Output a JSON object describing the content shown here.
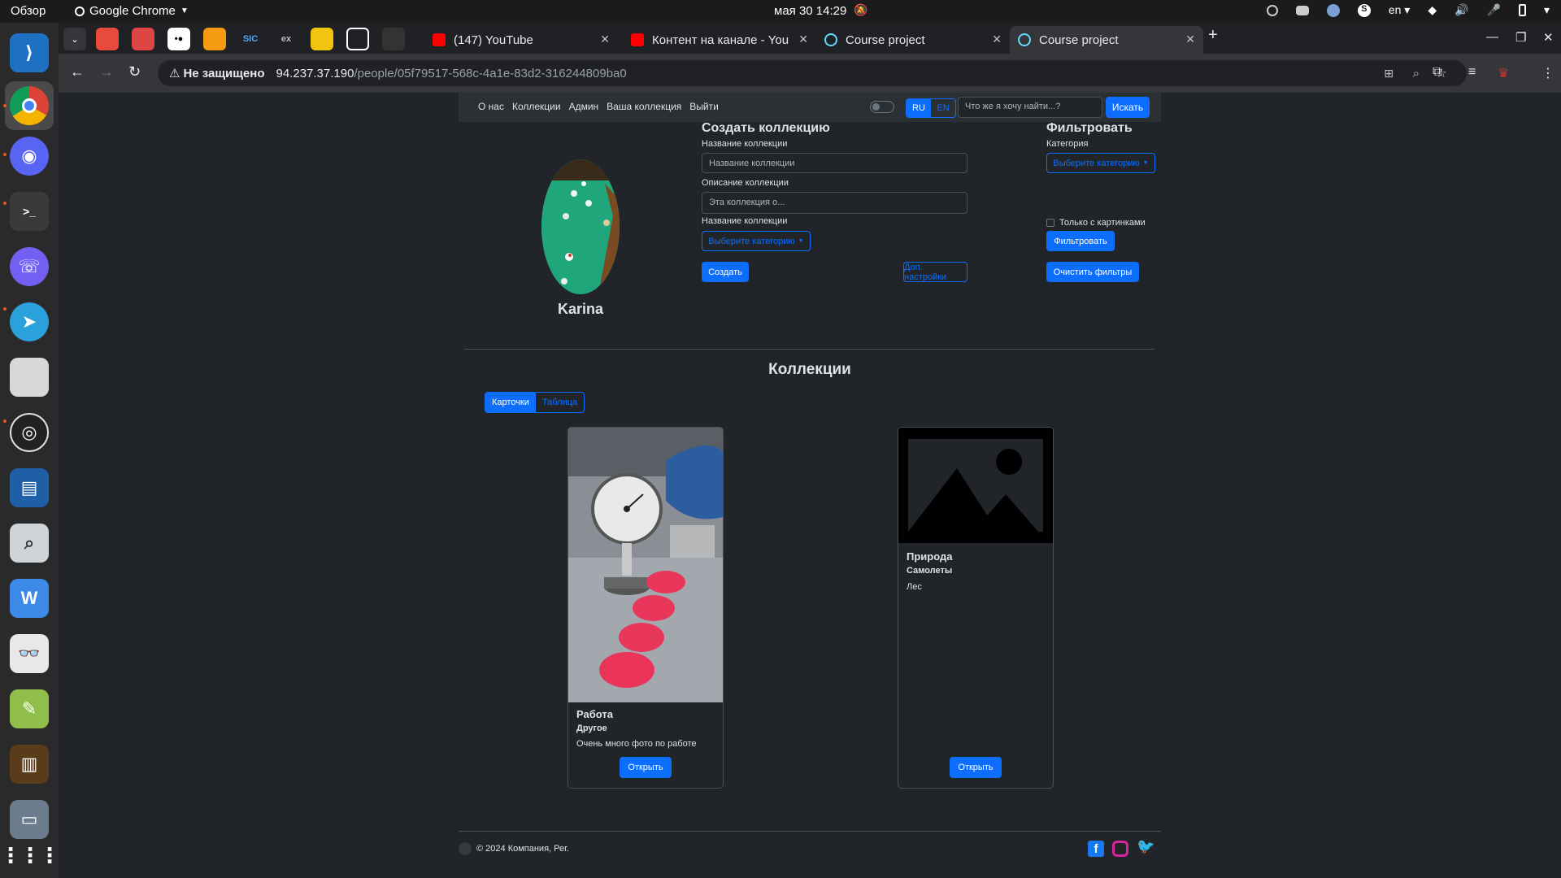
{
  "system": {
    "overview": "Обзор",
    "app_name": "Google Chrome",
    "clock": "мая 30  14:29",
    "lang": "en"
  },
  "browser": {
    "tabs": [
      {
        "label": "(147) YouTube"
      },
      {
        "label": "Контент на канале - You"
      },
      {
        "label": "Course project"
      },
      {
        "label": "Course project"
      }
    ],
    "small_tabs": [
      "SIC",
      "ex"
    ],
    "insecure_label": "Не защищено",
    "url_host": "94.237.37.190",
    "url_path": "/people/05f79517-568c-4a1e-83d2-316244809ba0"
  },
  "nav": {
    "links": [
      "О нас",
      "Коллекции",
      "Админ",
      "Ваша коллекция",
      "Выйти"
    ],
    "lang_ru": "RU",
    "lang_en": "EN",
    "search_placeholder": "Что же я хочу найти...?",
    "search_button": "Искать"
  },
  "profile": {
    "name": "Karina"
  },
  "create": {
    "title": "Создать коллекцию",
    "name_label": "Название коллекции",
    "name_placeholder": "Название коллекции",
    "desc_label": "Описание коллекции",
    "desc_placeholder": "Эта коллекция о...",
    "category_label": "Название коллекции",
    "category_button": "Выберите категорию",
    "create_button": "Создать",
    "extra_button": "Доп. настройки"
  },
  "filter": {
    "title": "Фильтровать",
    "category_label": "Категория",
    "category_button": "Выберите категорию",
    "only_images_label": "Только с картинками",
    "filter_button": "Фильтровать",
    "clear_button": "Очистить фильтры"
  },
  "collections": {
    "title": "Коллекции",
    "view_cards": "Карточки",
    "view_table": "Таблица",
    "items": [
      {
        "title": "Работа",
        "category": "Другое",
        "description": "Очень много фото по работе",
        "open": "Открыть"
      },
      {
        "title": "Природа",
        "category": "Самолеты",
        "description": "Лес",
        "open": "Открыть"
      }
    ]
  },
  "footer": {
    "copyright": "© 2024 Компания, Рег."
  }
}
